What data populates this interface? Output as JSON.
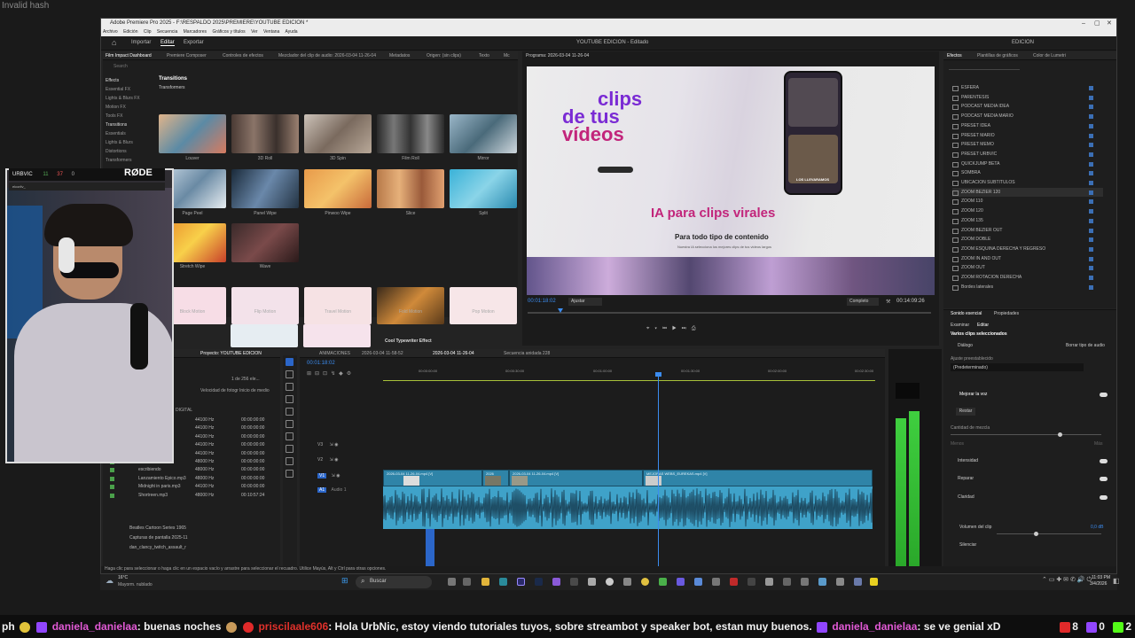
{
  "overlay": {
    "invalid_hash": "Invalid hash"
  },
  "window": {
    "title": "Adobe Premiere Pro 2025 - F:\\RESPALDO 2025\\PREMIERE\\YOUTUBE EDICION *",
    "menu": [
      "Archivo",
      "Edición",
      "Clip",
      "Secuencia",
      "Marcadores",
      "Gráficos y títulos",
      "Ver",
      "Ventana",
      "Ayuda"
    ],
    "workspace_tabs": [
      "Importar",
      "Editar",
      "Exportar"
    ],
    "center_title": "YOUTUBE EDICION - Editado",
    "right_label": "EDICION"
  },
  "source_panel": {
    "tabs": [
      "Film Impact Dashboard",
      "Premiere Composer",
      "Controles de efectos",
      "Mezclador del clip de audio: 2026-03-04 11-26-04",
      "Metadatos",
      "Origen: (sin clips)",
      "Texto",
      "Mc"
    ],
    "search_placeholder": "Search",
    "tree": [
      "Effects",
      "Essential FX",
      "Lights & Blurs FX",
      "Motion FX",
      "Tools FX",
      "Transitions",
      "Essentials",
      "Lights & Blurs",
      "Distortions",
      "Transformers"
    ],
    "section": "Transitions",
    "subsection": "Transformers",
    "row1": [
      "Louver",
      "3D Roll",
      "3D Spin",
      "Film Roll",
      "Mirror"
    ],
    "row2": [
      "Page Peel",
      "Panel Wipe",
      "Pinwoo Wipe",
      "Slice",
      "Split"
    ],
    "row3": [
      "Stretch Wipe",
      "Wave"
    ],
    "row3_section": "ion",
    "row4": [
      "Block Motion",
      "Flip Motion",
      "Travel Motion",
      "Fold Motion",
      "Pop Motion"
    ],
    "row5_label": "Cool Typewriter Effect"
  },
  "program": {
    "title": "Programa: 2026-03-04 11-26-04",
    "video_text": {
      "line1": "clips",
      "line2": "de tus",
      "line3": "vídeos",
      "headline": "IA para clips virales",
      "sub": "Para todo tipo de contenido",
      "small": "Nuestra IA selecciona los mejores clips de tus videos largos",
      "phone_tag": "LOS LLEVARAMOS"
    },
    "timecode": "00:01:18:02",
    "fit": "Ajustar",
    "quality": "Completo",
    "duration": "00:14:09:26"
  },
  "effects_panel": {
    "tabs": [
      "Efectos",
      "Plantillas de gráficos",
      "Color de Lumetri"
    ],
    "items": [
      "ESFERA",
      "PARENTESIS",
      "PODCAST MEDIA IDEA",
      "PODCAST MEDIA MARIO",
      "PRESET IDEA",
      "PRESET MARIO",
      "PRESET MEMO",
      "PRESET URBVIC",
      "QUICKJUMP BETA",
      "SOMBRA",
      "UBICACION SUBTITULOS",
      "ZOOM BEZIER 120",
      "ZOOM 110",
      "ZOOM 120",
      "ZOOM 135",
      "ZOOM BEZIER OUT",
      "ZOOM DOBLE",
      "ZOOM ESQUINA DERECHA Y REGRESO",
      "ZOOM IN AND OUT",
      "ZOOM OUT",
      "ZOOM ROTACION DERECHA",
      "Bordes laterales"
    ],
    "selected_index": 11
  },
  "essential_sound": {
    "tabs": [
      "Sonido esencial",
      "Propiedades"
    ],
    "subtabs": [
      "Examinar",
      "Editar"
    ],
    "header": "Varios clips seleccionados",
    "type": "Diálogo",
    "clear_type": "Borrar tipo de audio",
    "preset_label": "Ajuste preestablecido",
    "preset_value": "(Predeterminado)",
    "enhance": "Mejorar la voz",
    "reset": "Restar",
    "mix_amount": "Cantidad de mezcla",
    "slider_min": "Menos",
    "slider_max": "Más",
    "sections": [
      "Intensidad",
      "Reparar",
      "Claridad"
    ],
    "clip_volume": "Volumen del clip",
    "clip_volume_value": "0,0 dB",
    "mute": "Silenciar"
  },
  "project": {
    "tabs": [
      "Proyecto: YOUTUBE EDICION"
    ],
    "count": "1 de 256 ele...",
    "columns": [
      "Velocidad de fotogr",
      "Inicio de medio"
    ],
    "folder": "DIGITAL",
    "files": [
      {
        "name": "...mp3",
        "rate": "44100 Hz",
        "tc": "00:00:00:00",
        "color": "#4aa04a"
      },
      {
        "name": "...mp3",
        "rate": "44100 Hz",
        "tc": "00:00:00:00",
        "color": "#4aa04a"
      },
      {
        "name": "...mp3",
        "rate": "44100 Hz",
        "tc": "00:00:00:00",
        "color": "#4aa04a"
      },
      {
        "name": "...mp3",
        "rate": "44100 Hz",
        "tc": "00:00:00:00",
        "color": "#4aa04a"
      },
      {
        "name": "...mp3",
        "rate": "44100 Hz",
        "tc": "00:00:00:00",
        "color": "#4aa04a"
      },
      {
        "name": "SUSPENSE.mp3",
        "rate": "48000 Hz",
        "tc": "00:00:00:00",
        "color": "#4aa04a"
      },
      {
        "name": "escribiendo",
        "rate": "48000 Hz",
        "tc": "00:00:00:00",
        "color": "#4aa04a"
      },
      {
        "name": "Lanzamiento Epico.mp3",
        "rate": "48000 Hz",
        "tc": "00:00:00:00",
        "color": "#4aa04a"
      },
      {
        "name": "Midnight in paris.mp3",
        "rate": "44100 Hz",
        "tc": "00:00:00:00",
        "color": "#4aa04a"
      },
      {
        "name": "Shortreen.mp3",
        "rate": "48000 Hz",
        "tc": "00:10:57:24",
        "color": "#4aa04a"
      }
    ],
    "bins": [
      "Beatles Cartoon Series 1965",
      "Capturas de pantalla 2025-11",
      "dan_clancy_twitch_assault_r"
    ]
  },
  "timeline": {
    "tabs": [
      "ANIMACIONES",
      "2026-03-04 11-58-52",
      "2026-03-04 11-26-04",
      "Secuencia anidada 228"
    ],
    "timecode": "00:01:18:02",
    "ruler": [
      "00:00:00:00",
      "00:00:30:00",
      "00:01:00:00",
      "00:01:30:00",
      "00:02:00:00",
      "00:02:30:00",
      "00:03:00"
    ],
    "tracks": [
      "V3",
      "V2",
      "V1",
      "A1"
    ],
    "audio_label": "Audio 1",
    "clips": [
      "2026-03-04 11-26-04.mp4 [V]",
      "2026",
      "2026-03-04 11-26-04.mp4 [V]",
      "MEJORAS WEBS_EUREKAS.mp4 [V]"
    ]
  },
  "status_text": "Haga clic para seleccionar o haga clic en un espacio vacío y arrastre para seleccionar el recuadro. Utilice Mayús, Alt y Ctrl para otras opciones.",
  "taskbar": {
    "weather": "16°C",
    "weather_desc": "Mayorm. nublado",
    "search": "Buscar",
    "time": "11:03 PM",
    "date": "3/4/2026"
  },
  "webcam": {
    "channel": "URBVIC",
    "stats": [
      "11",
      "37",
      "0"
    ],
    "brand": "RØDE",
    "sub_user": "elcorilv_"
  },
  "chat": [
    {
      "user": "daniela_danielaa",
      "msg": ": buenas noches"
    },
    {
      "user": "priscilaale606",
      "msg": ": Hola UrbNic, estoy viendo tutoriales tuyos, sobre streambot y speaker bot, estan muy buenos."
    },
    {
      "user": "daniela_danielaa",
      "msg": ": se ve genial xD"
    }
  ],
  "counts": {
    "youtube": "8",
    "twitch": "0",
    "kick": "2"
  },
  "chat_prefix": "ph",
  "colors": {
    "accent": "#3b8cf0",
    "clip_video": "#2f84a8",
    "clip_audio": "#3fa2c9",
    "meter": "#3fcf3f"
  }
}
